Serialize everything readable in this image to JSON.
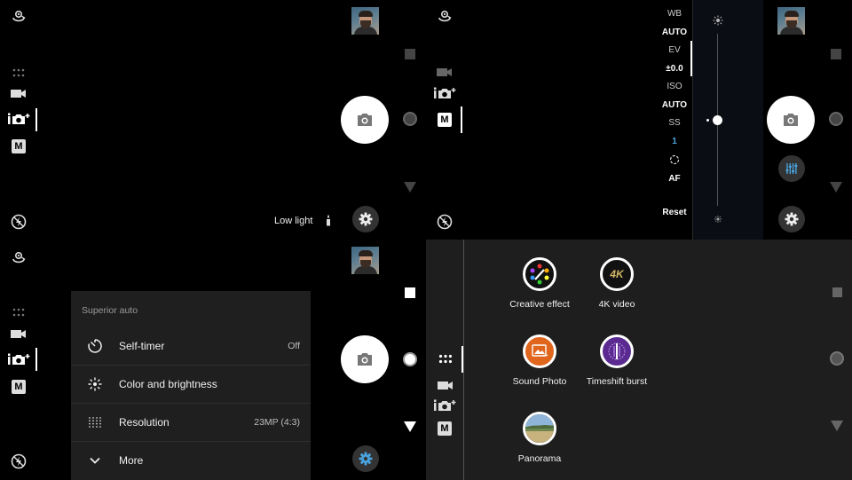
{
  "colors": {
    "background": "#000000",
    "accent": "#4aa3df",
    "menu_bg": "#1f1f1f",
    "grid_bg": "#1e1e1e"
  },
  "modes": {
    "icons": [
      "rotate-camera-icon",
      "apps-grid-icon",
      "video-icon",
      "superior-auto-icon",
      "manual-icon",
      "flash-icon"
    ],
    "manual_label": "M"
  },
  "top_left": {
    "scene_label": "Low light"
  },
  "manual_panel": {
    "items": [
      {
        "key": "wb_label",
        "text": "WB"
      },
      {
        "key": "wb_value",
        "text": "AUTO"
      },
      {
        "key": "ev_label",
        "text": "EV"
      },
      {
        "key": "ev_value",
        "text": "±0.0"
      },
      {
        "key": "iso_label",
        "text": "ISO"
      },
      {
        "key": "iso_value",
        "text": "AUTO"
      },
      {
        "key": "ss_label",
        "text": "SS"
      },
      {
        "key": "ss_value",
        "text": "1"
      },
      {
        "key": "af_value",
        "text": "AF"
      },
      {
        "key": "reset",
        "text": "Reset"
      }
    ],
    "slider_level": 0.5
  },
  "settings_menu": {
    "title": "Superior auto",
    "rows": [
      {
        "label": "Self-timer",
        "value": "Off",
        "icon": "timer-icon"
      },
      {
        "label": "Color and brightness",
        "value": "",
        "icon": "brightness-icon"
      },
      {
        "label": "Resolution",
        "value": "23MP (4:3)",
        "icon": "resolution-icon"
      },
      {
        "label": "More",
        "value": "",
        "icon": "chevron-down-icon"
      }
    ]
  },
  "apps": [
    {
      "label": "Creative effect",
      "icon": "creative-effect-icon"
    },
    {
      "label": "4K video",
      "icon": "4k-video-icon",
      "badge": "4K"
    },
    {
      "label": "Sound Photo",
      "icon": "sound-photo-icon"
    },
    {
      "label": "Timeshift burst",
      "icon": "timeshift-burst-icon"
    },
    {
      "label": "Panorama",
      "icon": "panorama-icon"
    }
  ]
}
